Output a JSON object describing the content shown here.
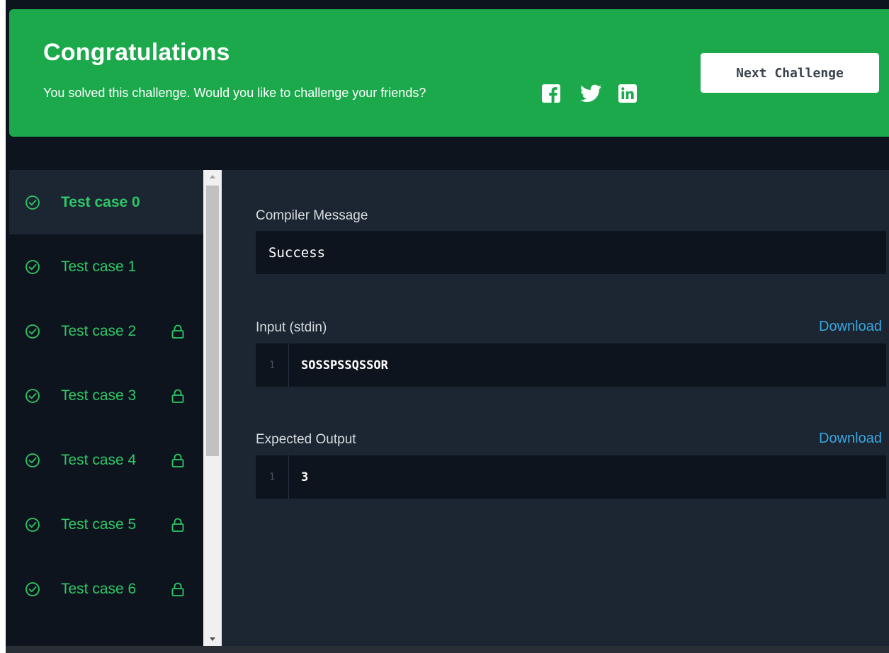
{
  "banner": {
    "title": "Congratulations",
    "subtitle": "You solved this challenge. Would you like to challenge your friends?",
    "next_button": "Next Challenge",
    "social_icons": [
      "facebook-icon",
      "twitter-icon",
      "linkedin-icon"
    ]
  },
  "test_cases": [
    {
      "label": "Test case 0",
      "active": true,
      "locked": false,
      "passed": true
    },
    {
      "label": "Test case 1",
      "active": false,
      "locked": false,
      "passed": true
    },
    {
      "label": "Test case 2",
      "active": false,
      "locked": true,
      "passed": true
    },
    {
      "label": "Test case 3",
      "active": false,
      "locked": true,
      "passed": true
    },
    {
      "label": "Test case 4",
      "active": false,
      "locked": true,
      "passed": true
    },
    {
      "label": "Test case 5",
      "active": false,
      "locked": true,
      "passed": true
    },
    {
      "label": "Test case 6",
      "active": false,
      "locked": true,
      "passed": true
    }
  ],
  "compiler": {
    "label": "Compiler Message",
    "message": "Success"
  },
  "input": {
    "label": "Input (stdin)",
    "download": "Download",
    "line_number": "1",
    "value": "SOSSPSSQSSOR"
  },
  "expected": {
    "label": "Expected Output",
    "download": "Download",
    "line_number": "1",
    "value": "3"
  },
  "colors": {
    "banner_green": "#1ba94c",
    "pass_green": "#2ec866",
    "link_blue": "#39a7e0",
    "dark_bg": "#0e141e",
    "panel_bg": "#1c2532"
  }
}
